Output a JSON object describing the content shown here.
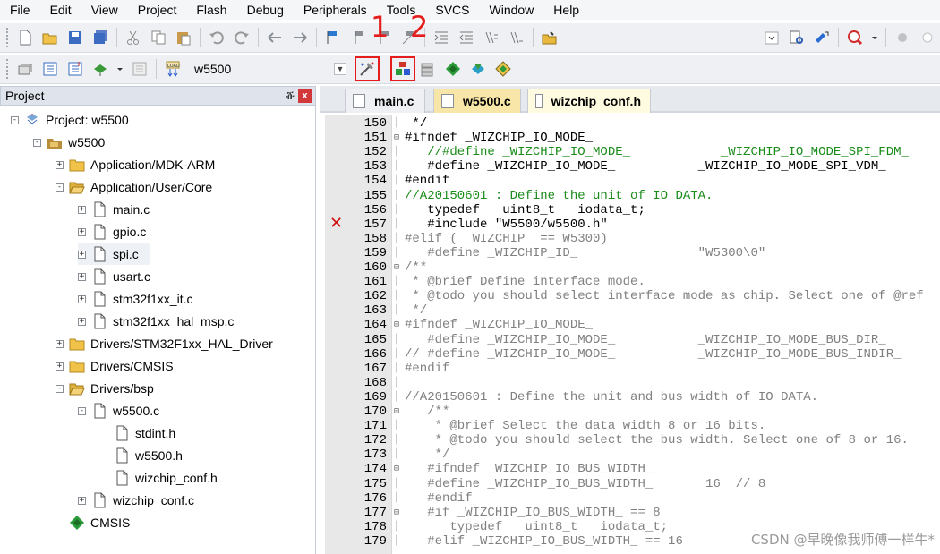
{
  "menu": [
    "File",
    "Edit",
    "View",
    "Project",
    "Flash",
    "Debug",
    "Peripherals",
    "Tools",
    "SVCS",
    "Window",
    "Help"
  ],
  "toolbar": {
    "target_name": "w5500",
    "annotation_1": "1",
    "annotation_2": "2"
  },
  "project_panel": {
    "title": "Project",
    "pin_glyph": "ⶡ",
    "close_glyph": "x",
    "tree": [
      {
        "label": "Project: w5500",
        "indent": 0,
        "expander": "-",
        "icon": "project-icon"
      },
      {
        "label": "w5500",
        "indent": 1,
        "expander": "-",
        "icon": "target-icon"
      },
      {
        "label": "Application/MDK-ARM",
        "indent": 2,
        "expander": "+",
        "icon": "folder-icon"
      },
      {
        "label": "Application/User/Core",
        "indent": 2,
        "expander": "-",
        "icon": "folder-open-icon"
      },
      {
        "label": "main.c",
        "indent": 3,
        "expander": "+",
        "icon": "file-icon"
      },
      {
        "label": "gpio.c",
        "indent": 3,
        "expander": "+",
        "icon": "file-icon"
      },
      {
        "label": "spi.c",
        "indent": 3,
        "expander": "+",
        "icon": "file-icon",
        "selected": true
      },
      {
        "label": "usart.c",
        "indent": 3,
        "expander": "+",
        "icon": "file-icon"
      },
      {
        "label": "stm32f1xx_it.c",
        "indent": 3,
        "expander": "+",
        "icon": "file-icon"
      },
      {
        "label": "stm32f1xx_hal_msp.c",
        "indent": 3,
        "expander": "+",
        "icon": "file-icon"
      },
      {
        "label": "Drivers/STM32F1xx_HAL_Driver",
        "indent": 2,
        "expander": "+",
        "icon": "folder-icon"
      },
      {
        "label": "Drivers/CMSIS",
        "indent": 2,
        "expander": "+",
        "icon": "folder-icon"
      },
      {
        "label": "Drivers/bsp",
        "indent": 2,
        "expander": "-",
        "icon": "folder-open-icon"
      },
      {
        "label": "w5500.c",
        "indent": 3,
        "expander": "-",
        "icon": "file-icon"
      },
      {
        "label": "stdint.h",
        "indent": 4,
        "expander": "",
        "icon": "file-icon"
      },
      {
        "label": "w5500.h",
        "indent": 4,
        "expander": "",
        "icon": "file-icon"
      },
      {
        "label": "wizchip_conf.h",
        "indent": 4,
        "expander": "",
        "icon": "file-icon"
      },
      {
        "label": "wizchip_conf.c",
        "indent": 3,
        "expander": "+",
        "icon": "file-icon"
      },
      {
        "label": "CMSIS",
        "indent": 2,
        "expander": "",
        "icon": "cmsis-icon"
      }
    ]
  },
  "tabs": [
    {
      "label": "main.c",
      "style": "normal"
    },
    {
      "label": "w5500.c",
      "style": "yellow"
    },
    {
      "label": "wizchip_conf.h",
      "style": "active"
    }
  ],
  "editor": {
    "error_line": 157,
    "lines": [
      {
        "n": "150",
        "fold": "",
        "text": " */",
        "color": "#000000"
      },
      {
        "n": "151",
        "fold": "-",
        "text": "#ifndef _WIZCHIP_IO_MODE_",
        "color": "#000000"
      },
      {
        "n": "152",
        "fold": "",
        "text": "   //#define _WIZCHIP_IO_MODE_            _WIZCHIP_IO_MODE_SPI_FDM_",
        "color": "#1a8c1a"
      },
      {
        "n": "153",
        "fold": "",
        "text": "   #define _WIZCHIP_IO_MODE_           _WIZCHIP_IO_MODE_SPI_VDM_",
        "color": "#000000"
      },
      {
        "n": "154",
        "fold": "",
        "text": "#endif",
        "color": "#000000"
      },
      {
        "n": "155",
        "fold": "",
        "text": "//A20150601 : Define the unit of IO DATA.",
        "color": "#1a8c1a"
      },
      {
        "n": "156",
        "fold": "",
        "text": "   typedef   uint8_t   iodata_t;",
        "color": "#000000"
      },
      {
        "n": "157",
        "fold": "",
        "text": "   #include \"W5500/w5500.h\"",
        "color": "#000000"
      },
      {
        "n": "158",
        "fold": "",
        "text": "#elif ( _WIZCHIP_ == W5300)",
        "color": "#808080"
      },
      {
        "n": "159",
        "fold": "",
        "text": "   #define _WIZCHIP_ID_                \"W5300\\0\"",
        "color": "#808080"
      },
      {
        "n": "160",
        "fold": "-",
        "text": "/**",
        "color": "#808080"
      },
      {
        "n": "161",
        "fold": "",
        "text": " * @brief Define interface mode.",
        "color": "#808080"
      },
      {
        "n": "162",
        "fold": "",
        "text": " * @todo you should select interface mode as chip. Select one of @ref",
        "color": "#808080"
      },
      {
        "n": "163",
        "fold": "",
        "text": " */",
        "color": "#808080"
      },
      {
        "n": "164",
        "fold": "-",
        "text": "#ifndef _WIZCHIP_IO_MODE_",
        "color": "#808080"
      },
      {
        "n": "165",
        "fold": "",
        "text": "   #define _WIZCHIP_IO_MODE_           _WIZCHIP_IO_MODE_BUS_DIR_",
        "color": "#808080"
      },
      {
        "n": "166",
        "fold": "",
        "text": "// #define _WIZCHIP_IO_MODE_           _WIZCHIP_IO_MODE_BUS_INDIR_",
        "color": "#808080"
      },
      {
        "n": "167",
        "fold": "",
        "text": "#endif",
        "color": "#808080"
      },
      {
        "n": "168",
        "fold": "",
        "text": "",
        "color": "#808080"
      },
      {
        "n": "169",
        "fold": "",
        "text": "//A20150601 : Define the unit and bus width of IO DATA.",
        "color": "#808080"
      },
      {
        "n": "170",
        "fold": "-",
        "text": "   /**",
        "color": "#808080"
      },
      {
        "n": "171",
        "fold": "",
        "text": "    * @brief Select the data width 8 or 16 bits.",
        "color": "#808080"
      },
      {
        "n": "172",
        "fold": "",
        "text": "    * @todo you should select the bus width. Select one of 8 or 16.",
        "color": "#808080"
      },
      {
        "n": "173",
        "fold": "",
        "text": "    */",
        "color": "#808080"
      },
      {
        "n": "174",
        "fold": "-",
        "text": "   #ifndef _WIZCHIP_IO_BUS_WIDTH_",
        "color": "#808080"
      },
      {
        "n": "175",
        "fold": "",
        "text": "   #define _WIZCHIP_IO_BUS_WIDTH_       16  // 8",
        "color": "#808080"
      },
      {
        "n": "176",
        "fold": "",
        "text": "   #endif",
        "color": "#808080"
      },
      {
        "n": "177",
        "fold": "-",
        "text": "   #if _WIZCHIP_IO_BUS_WIDTH_ == 8",
        "color": "#808080"
      },
      {
        "n": "178",
        "fold": "",
        "text": "      typedef   uint8_t   iodata_t;",
        "color": "#808080"
      },
      {
        "n": "179",
        "fold": "",
        "text": "   #elif _WIZCHIP_IO_BUS_WIDTH_ == 16",
        "color": "#808080"
      }
    ]
  },
  "watermark": "CSDN @早晚像我师傅一样牛*"
}
